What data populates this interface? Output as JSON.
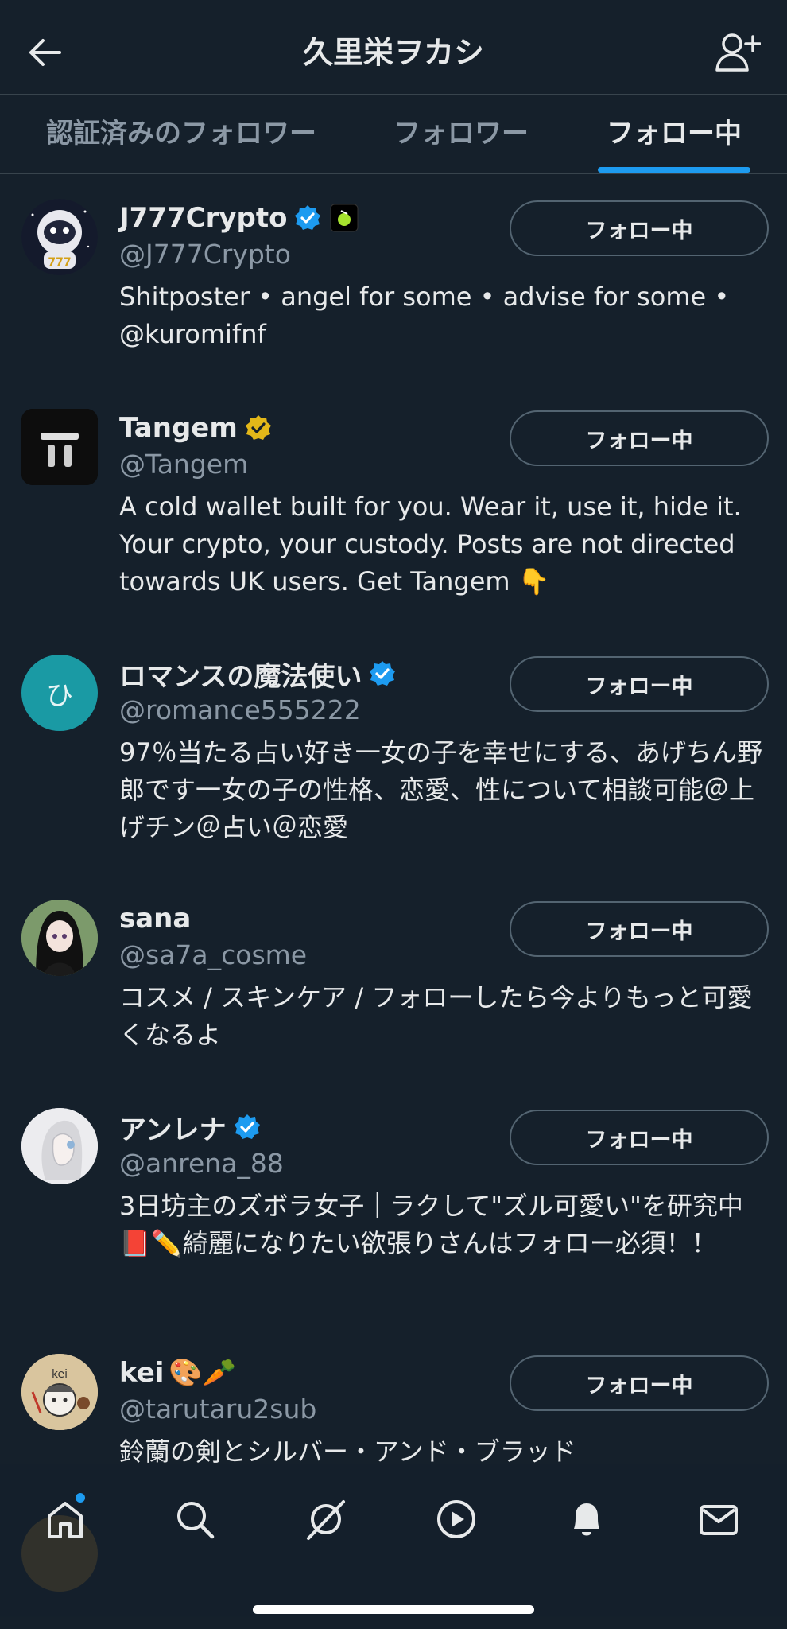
{
  "header": {
    "title": "久里栄ヲカシ",
    "back_icon": "arrow-left-icon",
    "add_user_icon": "add-user-icon"
  },
  "tabs": [
    {
      "label": "認証済みのフォロワー",
      "active": false
    },
    {
      "label": "フォロワー",
      "active": false
    },
    {
      "label": "フォロー中",
      "active": true
    }
  ],
  "users": [
    {
      "name": "J777Crypto",
      "handle": "@J777Crypto",
      "verified": "blue",
      "bio": "Shitposter • angel for some • advise for some • @kuromifnf",
      "button": "フォロー中"
    },
    {
      "name": "Tangem",
      "handle": "@Tangem",
      "verified": "gold",
      "bio": "A cold wallet built for you. Wear it, use it, hide it. Your crypto, your custody. Posts are not directed towards UK users. Get Tangem 👇",
      "button": "フォロー中"
    },
    {
      "name": "ロマンスの魔法使い",
      "handle": "@romance555222",
      "verified": "blue",
      "avatar_letter": "ひ",
      "bio": "97％当たる占い好き一女の子を幸せにする、あげちん野郎です一女の子の性格、恋愛、性について相談可能＠上げチン＠占い＠恋愛",
      "button": "フォロー中"
    },
    {
      "name": "sana",
      "handle": "@sa7a_cosme",
      "verified": "none",
      "bio": "コスメ / スキンケア / フォローしたら今よりもっと可愛くなるよ",
      "button": "フォロー中"
    },
    {
      "name": "アンレナ",
      "handle": "@anrena_88",
      "verified": "blue",
      "bio": "3日坊主のズボラ女子｜ラクして\"ズル可愛い\"を研究中📕✏️綺麗になりたい欲張りさんはフォロー必須！！",
      "button": "フォロー中"
    },
    {
      "name": "kei",
      "name_emoji": "🎨🥕",
      "handle": "@tarutaru2sub",
      "verified": "none",
      "bio": "鈴蘭の剣とシルバー・アンド・ブラッド",
      "button": "フォロー中"
    }
  ],
  "nav": [
    "home-icon",
    "search-icon",
    "grok-icon",
    "video-icon",
    "notifications-icon",
    "messages-icon"
  ],
  "colors": {
    "background": "#15202b",
    "accent": "#1d9bf0",
    "muted": "#8b98a5",
    "gold": "#e2b719"
  }
}
